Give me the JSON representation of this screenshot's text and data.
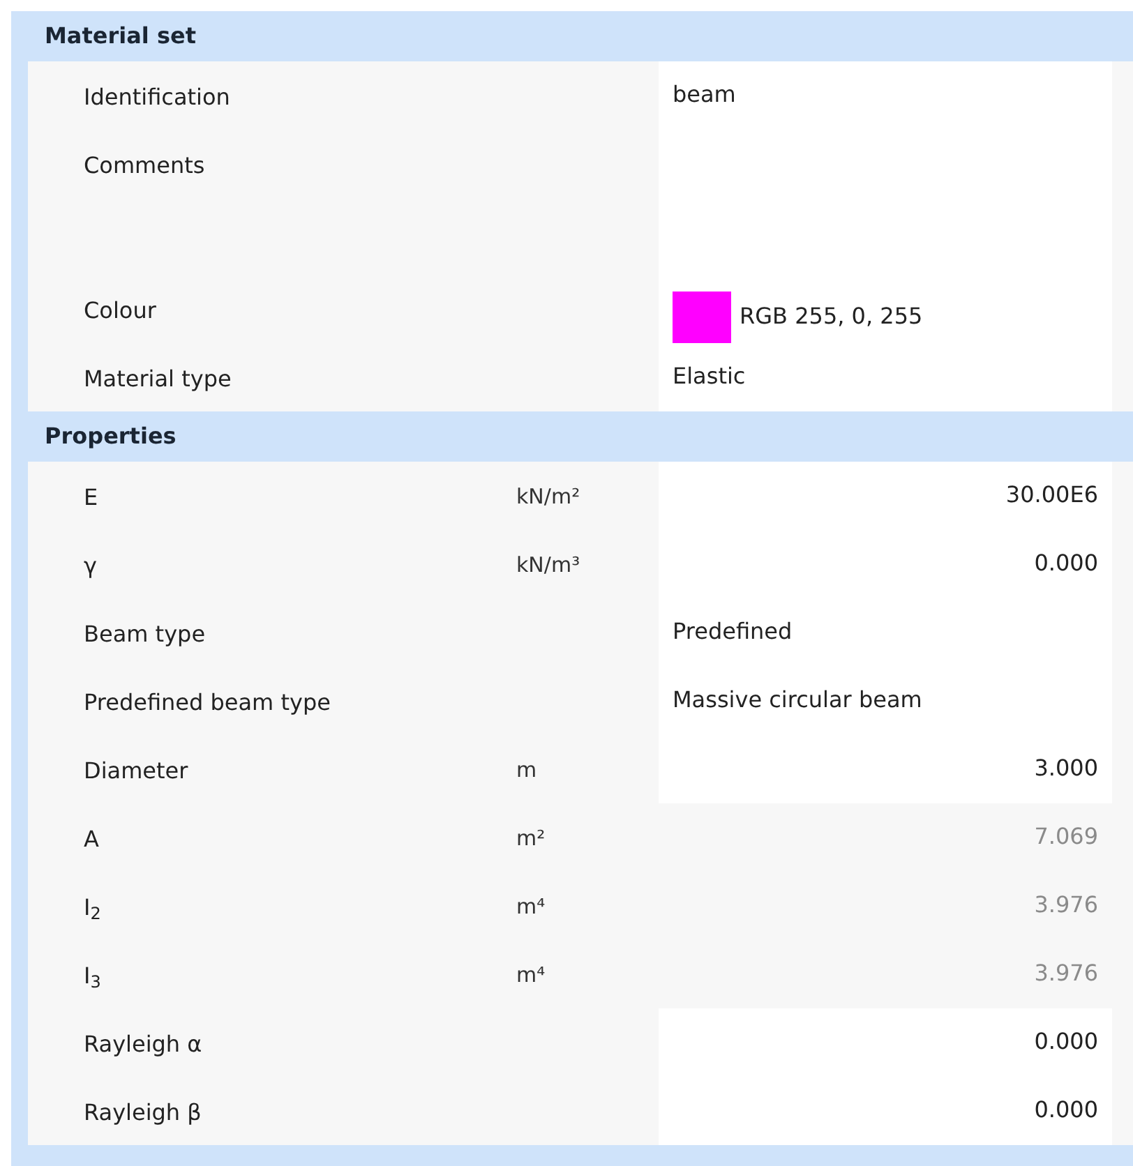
{
  "sections": [
    {
      "title": "Material set",
      "rows": [
        {
          "kind": "text",
          "label": "Identification",
          "value": "beam",
          "disabled": false
        },
        {
          "kind": "multiline",
          "label": "Comments"
        },
        {
          "kind": "color",
          "label": "Colour",
          "value": "RGB 255, 0, 255",
          "color": "#ff00ff",
          "disabled": false
        },
        {
          "kind": "text",
          "label": "Material type",
          "value": "Elastic",
          "disabled": false
        }
      ]
    },
    {
      "title": "Properties",
      "rows": [
        {
          "kind": "number",
          "label": "E",
          "unit": "kN/m²",
          "value": "30.00E6",
          "disabled": false
        },
        {
          "kind": "number",
          "label": "γ",
          "unit": "kN/m³",
          "value": "0.000",
          "disabled": false
        },
        {
          "kind": "text",
          "label": "Beam type",
          "value": "Predefined",
          "disabled": false
        },
        {
          "kind": "text",
          "label": "Predefined beam type",
          "value": "Massive circular beam",
          "disabled": false
        },
        {
          "kind": "number",
          "label": "Diameter",
          "unit": "m",
          "value": "3.000",
          "disabled": false
        },
        {
          "kind": "number",
          "label": "A",
          "unit": "m²",
          "value": "7.069",
          "disabled": true
        },
        {
          "kind": "number",
          "label": "I$_{2}$",
          "unit": "m⁴",
          "value": "3.976",
          "disabled": true
        },
        {
          "kind": "number",
          "label": "I$_{3}$",
          "unit": "m⁴",
          "value": "3.976",
          "disabled": true
        },
        {
          "kind": "number",
          "label": "Rayleigh α",
          "value": "0.000",
          "disabled": false
        },
        {
          "kind": "number",
          "label": "Rayleigh β",
          "value": "0.000",
          "disabled": false
        }
      ]
    }
  ]
}
